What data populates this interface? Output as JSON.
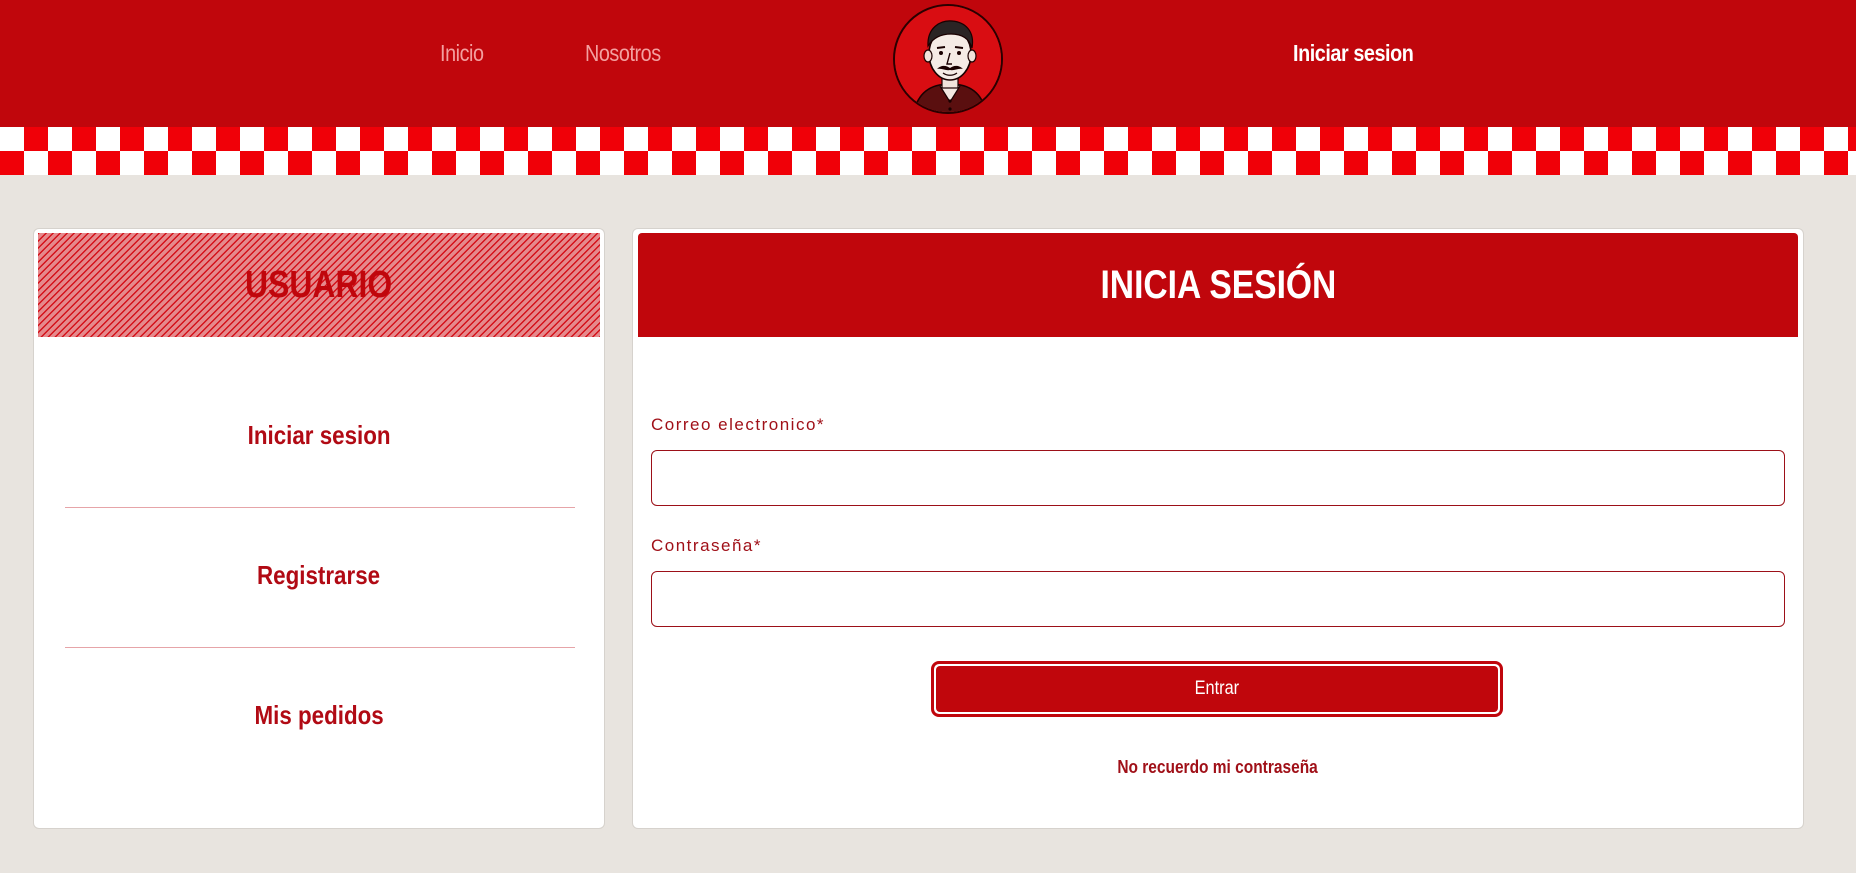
{
  "nav": {
    "inicio_label": "Inicio",
    "nosotros_label": "Nosotros",
    "login_label": "Iniciar sesion"
  },
  "colors": {
    "brand_red": "#c0060c",
    "checker_red": "#f00008",
    "page_background": "#e8e4df",
    "text_red": "#b10a14"
  },
  "user_panel": {
    "title": "USUARIO",
    "items": [
      {
        "label": "Iniciar sesion"
      },
      {
        "label": "Registrarse"
      },
      {
        "label": "Mis pedidos"
      }
    ]
  },
  "login_panel": {
    "title": "INICIA SESIÓN",
    "email_label": "Correo electronico*",
    "email_value": "",
    "password_label": "Contraseña*",
    "password_value": "",
    "submit_label": "Entrar",
    "forgot_label": "No recuerdo mi contraseña"
  }
}
